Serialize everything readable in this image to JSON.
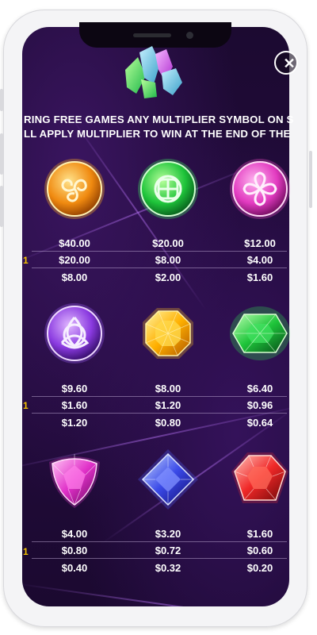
{
  "close_button": {
    "glyph": "✕",
    "icon": "close-icon"
  },
  "rules": {
    "line1": "RING FREE GAMES ANY MULTIPLIER SYMBOL ON SCRE",
    "line2": "LL APPLY MULTIPLIER TO WIN AT THE END OF THE SP"
  },
  "multiplier_marker": "1",
  "colors": {
    "background": "#1e0a35",
    "multiplier": "#f4c400",
    "text": "#ffffff"
  },
  "paytable": [
    {
      "symbols": [
        {
          "name": "triskelion-orange",
          "icon": "triskelion-icon",
          "payouts": [
            "$40.00",
            "$20.00",
            "$8.00"
          ]
        },
        {
          "name": "celtic-knot-green",
          "icon": "celtic-knot-icon",
          "payouts": [
            "$20.00",
            "$8.00",
            "$2.00"
          ]
        },
        {
          "name": "quatrefoil-pink",
          "icon": "quatrefoil-knot-icon",
          "payouts": [
            "$12.00",
            "$4.00",
            "$1.60"
          ]
        }
      ]
    },
    {
      "symbols": [
        {
          "name": "triquetra-purple",
          "icon": "triquetra-icon",
          "payouts": [
            "$9.60",
            "$1.60",
            "$1.20"
          ]
        },
        {
          "name": "octagon-gem-yellow",
          "icon": "yellow-gem-icon",
          "payouts": [
            "$8.00",
            "$1.20",
            "$0.80"
          ]
        },
        {
          "name": "oval-gem-green",
          "icon": "green-gem-icon",
          "payouts": [
            "$6.40",
            "$0.96",
            "$0.64"
          ]
        }
      ]
    },
    {
      "symbols": [
        {
          "name": "trillion-gem-pink",
          "icon": "pink-gem-icon",
          "payouts": [
            "$4.00",
            "$0.80",
            "$0.40"
          ]
        },
        {
          "name": "diamond-gem-blue",
          "icon": "blue-gem-icon",
          "payouts": [
            "$3.20",
            "$0.72",
            "$0.32"
          ]
        },
        {
          "name": "hex-gem-red",
          "icon": "red-gem-icon",
          "payouts": [
            "$1.60",
            "$0.60",
            "$0.20"
          ]
        }
      ]
    }
  ]
}
